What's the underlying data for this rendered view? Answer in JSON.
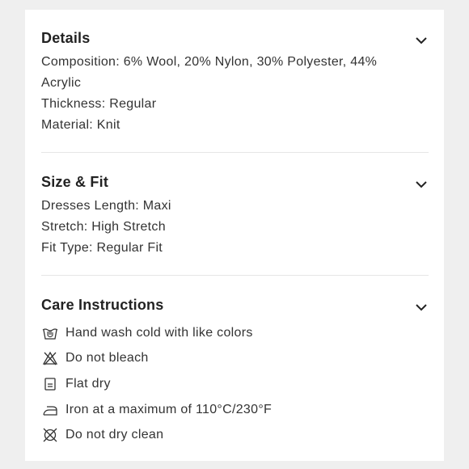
{
  "details": {
    "title": "Details",
    "lines": [
      "Composition: 6% Wool, 20% Nylon, 30% Polyester, 44%",
      "Acrylic",
      "Thickness: Regular",
      "Material: Knit"
    ]
  },
  "size_fit": {
    "title": "Size & Fit",
    "lines": [
      "Dresses Length: Maxi",
      "Stretch: High Stretch",
      "Fit Type: Regular Fit"
    ]
  },
  "care": {
    "title": "Care Instructions",
    "items": [
      {
        "icon": "hand-wash-icon",
        "label": "Hand wash cold with like colors"
      },
      {
        "icon": "no-bleach-icon",
        "label": "Do not bleach"
      },
      {
        "icon": "flat-dry-icon",
        "label": "Flat dry"
      },
      {
        "icon": "iron-icon",
        "label": "Iron at a maximum of 110°C/230°F"
      },
      {
        "icon": "no-dry-clean-icon",
        "label": "Do not dry clean"
      }
    ]
  }
}
